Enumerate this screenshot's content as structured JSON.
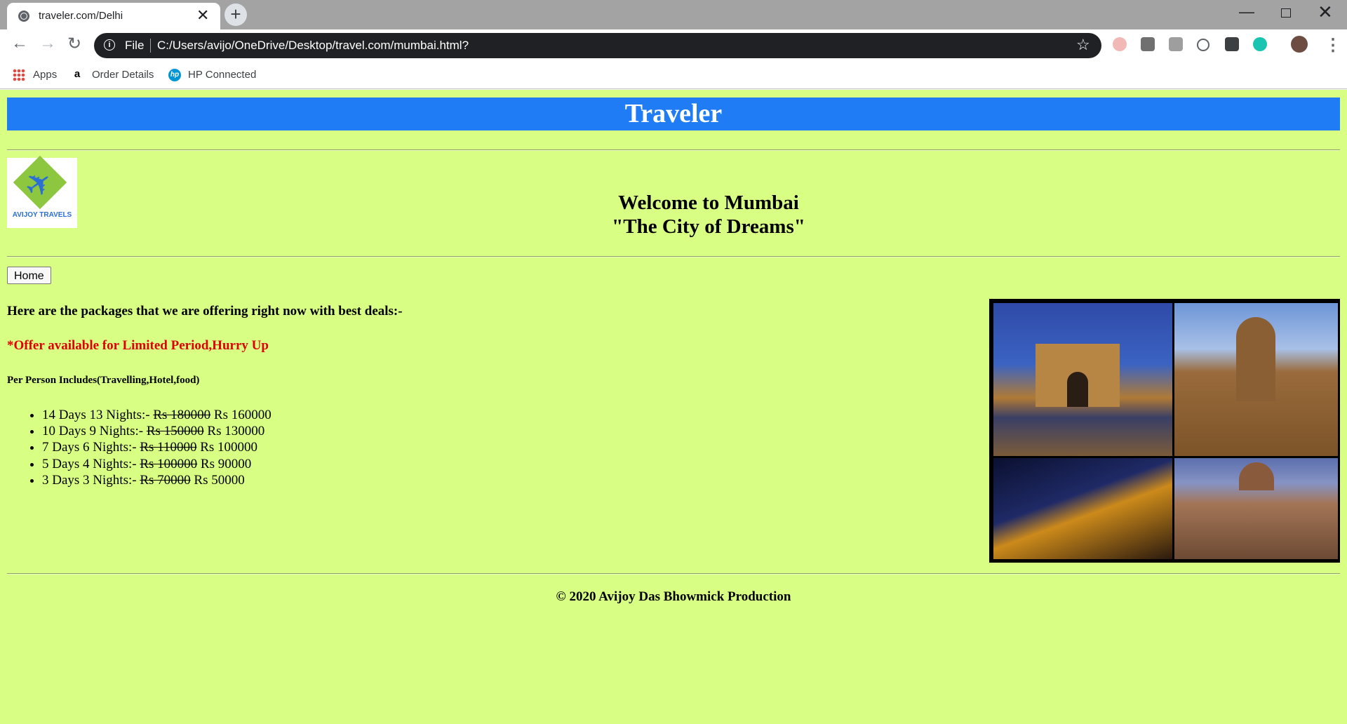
{
  "browser": {
    "tab_title": "traveler.com/Delhi",
    "tab_close": "✕",
    "new_tab": "+",
    "url_scheme": "File",
    "url": "C:/Users/avijo/OneDrive/Desktop/travel.com/mumbai.html?",
    "bookmarks": {
      "apps": "Apps",
      "order_details": "Order Details",
      "hp_connected": "HP Connected"
    }
  },
  "page": {
    "site_title": "Traveler",
    "logo_text": "AVIJOY TRAVELS",
    "welcome_line1": "Welcome to Mumbai",
    "welcome_line2": "\"The City of Dreams\"",
    "home_button": "Home",
    "intro": "Here are the packages that we are offering right now with best deals:-",
    "offer": "*Offer available for Limited Period,Hurry Up",
    "includes": "Per Person Includes(Travelling,Hotel,food)",
    "packages": [
      {
        "duration": "14 Days 13 Nights:-",
        "old_price": "Rs 180000",
        "new_price": "Rs 160000"
      },
      {
        "duration": "10 Days 9 Nights:-",
        "old_price": "Rs 150000",
        "new_price": "Rs 130000"
      },
      {
        "duration": "7 Days 6 Nights:-",
        "old_price": "Rs 110000",
        "new_price": "Rs 100000"
      },
      {
        "duration": "5 Days 4 Nights:-",
        "old_price": "Rs 100000",
        "new_price": "Rs 90000"
      },
      {
        "duration": "3 Days 3 Nights:-",
        "old_price": "Rs 70000",
        "new_price": "Rs 50000"
      }
    ],
    "footer": "© 2020 Avijoy Das Bhowmick Production"
  },
  "colors": {
    "page_background": "#d8fe84",
    "header_bar": "#1f7cf5",
    "offer_text": "#e00000"
  },
  "icons": [
    "back-icon",
    "forward-icon",
    "reload-icon",
    "info-icon",
    "star-icon",
    "menu-icon",
    "airplane-icon"
  ]
}
